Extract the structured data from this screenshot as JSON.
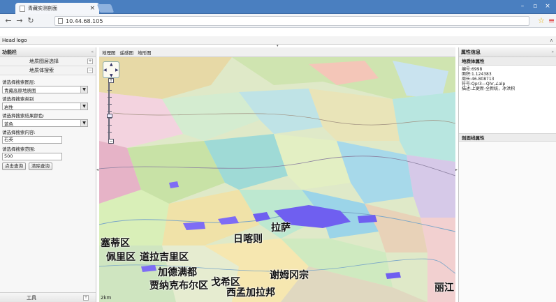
{
  "browser": {
    "tab_title": "青藏实测剖面",
    "url": "10.44.68.105"
  },
  "header": {
    "title": "Head logo"
  },
  "left_panel": {
    "title": "功能栏",
    "collapse_icon": "«",
    "sections": [
      {
        "label": "地质图层选择",
        "indicator": "+"
      },
      {
        "label": "地质体搜索",
        "indicator": "−"
      }
    ],
    "form": {
      "layer_label": "请选择搜索图层:",
      "layer_value": "青藏高原地质图",
      "category_label": "请选择搜索类别",
      "category_value": "岩性",
      "color_label": "请选择搜索结果颜色:",
      "color_value": "蓝色",
      "content_label": "请选择搜索内容:",
      "content_value": "石英",
      "range_label": "请选择搜索范围:",
      "range_value": "500",
      "query_button": "点击查询",
      "clear_button": "清除查询"
    },
    "tools": {
      "label": "工具",
      "indicator": "+"
    }
  },
  "map": {
    "tabs": [
      "地理图",
      "遥感图",
      "地形图"
    ],
    "scale_text": "2km",
    "places": [
      {
        "name": "拉萨"
      },
      {
        "name": "日喀则"
      },
      {
        "name": "塞蒂区"
      },
      {
        "name": "佩里区"
      },
      {
        "name": "道拉吉里区"
      },
      {
        "name": "加德满都"
      },
      {
        "name": "贾纳克布尔区"
      },
      {
        "name": "戈希区"
      },
      {
        "name": "谢姆冈宗"
      },
      {
        "name": "西孟加拉邦"
      },
      {
        "name": "丽江"
      }
    ]
  },
  "right_panel": {
    "title": "属性信息",
    "collapse_icon": "»",
    "geobody_header": "地质体属性",
    "props": [
      "编号:6998",
      "面积:1.124383",
      "周长:46.808713",
      "符号:Qpr3—Qhr,∠alp",
      "描述:上更新-全新统，冰洪积"
    ],
    "section_header": "剖面线属性"
  },
  "colors": {
    "accent": "#4a7fc0",
    "selection": "#6f5ff0"
  }
}
